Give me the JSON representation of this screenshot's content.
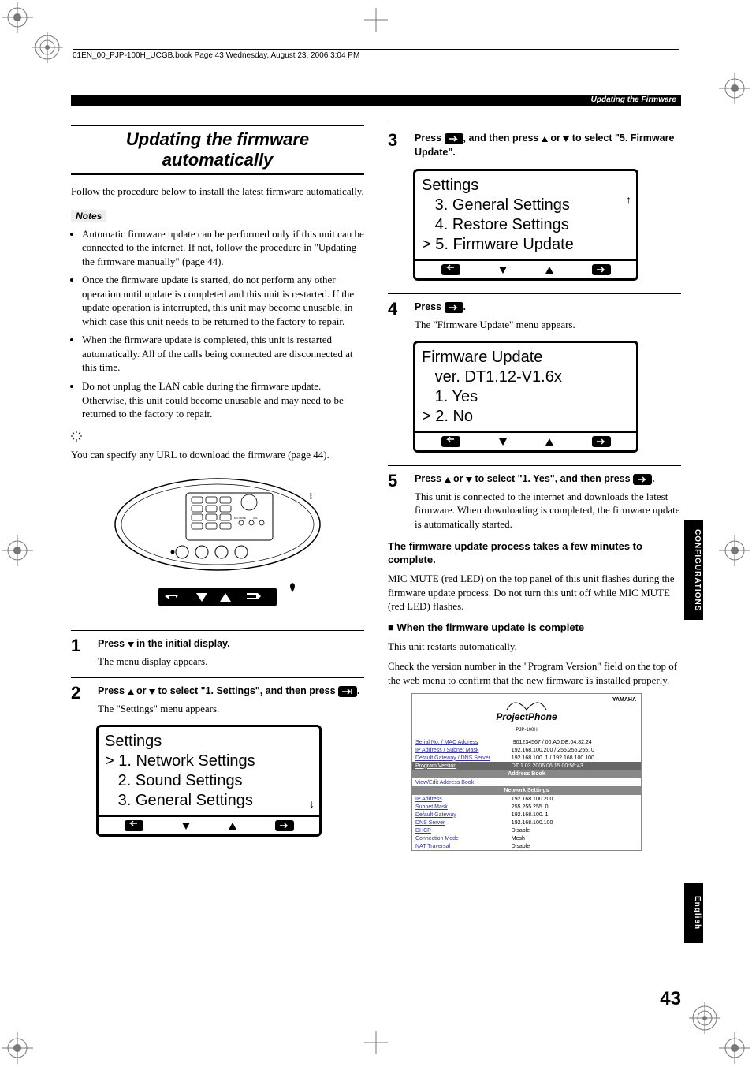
{
  "print_header": "01EN_00_PJP-100H_UCGB.book  Page 43  Wednesday, August 23, 2006  3:04 PM",
  "running_head": "Updating the Firmware",
  "title": "Updating the firmware automatically",
  "intro": "Follow the procedure below to install the latest firmware automatically.",
  "notes_label": "Notes",
  "notes": [
    "Automatic firmware update can be performed only if this unit can be connected to the internet. If not, follow the procedure in \"Updating the firmware manually\" (page 44).",
    "Once the firmware update is started, do not perform any other operation until update is completed and this unit is restarted. If the update operation is interrupted, this unit may become unusable, in which case this unit needs to be returned to the factory to repair.",
    "When the firmware update is completed, this unit is restarted automatically. All of the calls being connected are disconnected at this time.",
    "Do not unplug the LAN cable during the firmware update. Otherwise, this unit could become unusable and may need to be returned to the factory to repair."
  ],
  "tip": "You can specify any URL to download the firmware (page 44).",
  "steps": {
    "s1": {
      "num": "1",
      "head_a": "Press ",
      "head_b": " in the initial display.",
      "text": "The menu display appears."
    },
    "s2": {
      "num": "2",
      "head_a": "Press ",
      "head_b": " or ",
      "head_c": " to select \"1. Settings\", and then press ",
      "head_d": ".",
      "text": "The \"Settings\" menu appears."
    },
    "s3": {
      "num": "3",
      "head_a": "Press ",
      "head_b": ", and then press ",
      "head_c": " or ",
      "head_d": " to select \"5. Firmware Update\"."
    },
    "s4": {
      "num": "4",
      "head_a": "Press ",
      "head_b": ".",
      "text": "The \"Firmware Update\" menu appears."
    },
    "s5": {
      "num": "5",
      "head_a": "Press ",
      "head_b": " or ",
      "head_c": " to select \"1. Yes\", and then press ",
      "head_d": ".",
      "text": "This unit is connected to the internet and downloads the latest firmware. When downloading is completed, the firmware update is automatically started."
    }
  },
  "lcd1": {
    "title": "Settings",
    "l1": "> 1. Network Settings",
    "l2": "   2. Sound Settings",
    "l3": "   3. General Settings"
  },
  "lcd2": {
    "title": "Settings",
    "l1": "   3. General Settings",
    "l2": "   4. Restore Settings",
    "l3": "> 5. Firmware Update"
  },
  "lcd3": {
    "title": "Firmware Update",
    "l1": "   ver. DT1.12-V1.6x",
    "l2": "   1. Yes",
    "l3": "> 2. No"
  },
  "proc_note_head": "The firmware update process takes a few minutes to complete.",
  "proc_note_body": "MIC MUTE (red LED) on the top panel of this unit flashes during the firmware update process. Do not turn this unit off while MIC MUTE (red LED) flashes.",
  "complete_head": "When the firmware update is complete",
  "complete_p1": "This unit restarts automatically.",
  "complete_p2": "Check the version number in the \"Program Version\" field on the top of the web menu to confirm that the new firmware is installed properly.",
  "webmenu": {
    "brand": "YAMAHA",
    "logo": "ProjectPhone",
    "model": "PJP-100H",
    "rows": [
      [
        "Serial No. / MAC Address",
        "I901234567 / 00:A0:DE:04:82:24"
      ],
      [
        "IP Address / Subnet Mask",
        "192.168.100.200 / 255.255.255. 0"
      ],
      [
        "Default Gateway / DNS Server",
        "192.168.100. 1 / 192.168.100.100"
      ]
    ],
    "program_version_k": "Program Version",
    "program_version_v": "DT 1.03 2006.06.15 00:56:43",
    "ab_header": "Address Book",
    "ab_link": "View/Edit Address Book",
    "ns_header": "Network Settings",
    "ns_rows": [
      [
        "IP Address",
        "192.168.100.200"
      ],
      [
        "Subnet Mask",
        "255.255.255. 0"
      ],
      [
        "Default Gateway",
        "192.168.100. 1"
      ],
      [
        "DNS Server",
        "192.168.100.100"
      ],
      [
        "DHCP",
        "Disable"
      ],
      [
        "Connection Mode",
        "Mesh"
      ],
      [
        "NAT Traversal",
        "Disable"
      ]
    ]
  },
  "side_config": "CONFIGURATIONS",
  "side_english": "English",
  "page_number": "43"
}
